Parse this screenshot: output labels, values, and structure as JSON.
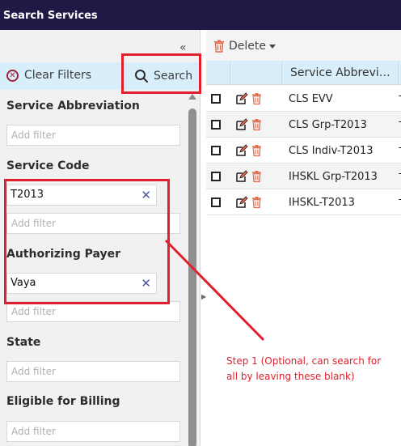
{
  "window": {
    "title": "Search Services"
  },
  "filters": {
    "collapse_glyph": "«",
    "clear_label": "Clear Filters",
    "search_label": "Search",
    "service_abbreviation": {
      "label": "Service Abbreviation",
      "placeholder": "Add filter"
    },
    "service_code": {
      "label": "Service Code",
      "chip": "T2013",
      "placeholder": "Add filter"
    },
    "authorizing_payer": {
      "label": "Authorizing Payer",
      "chip": "Vaya",
      "placeholder": "Add filter"
    },
    "state": {
      "label": "State",
      "placeholder": "Add filter"
    },
    "eligible_for_billing": {
      "label": "Eligible for Billing",
      "placeholder": "Add filter"
    },
    "chip_remove_glyph": "✕"
  },
  "grid": {
    "delete_label": "Delete",
    "column_header": "Service Abbrevi…",
    "rows": [
      {
        "abbreviation": "CLS EVV",
        "tail": "T"
      },
      {
        "abbreviation": "CLS Grp-T2013",
        "tail": "T"
      },
      {
        "abbreviation": "CLS Indiv-T2013",
        "tail": "T"
      },
      {
        "abbreviation": "IHSKL Grp-T2013",
        "tail": "T"
      },
      {
        "abbreviation": "IHSKL-T2013",
        "tail": "T"
      }
    ]
  },
  "annotation": {
    "text": "Step 1 (Optional, can search for all by leaving these blank)",
    "color": "#e0202e"
  },
  "colors": {
    "titlebar": "#1f1a45",
    "filter_bar": "#d9eefb",
    "accent_red": "#e0202e",
    "trash": "#e06a4a",
    "chip_x": "#4a56a8"
  },
  "icons": [
    "collapse-icon",
    "clear-filter-icon",
    "search-icon",
    "trash-icon",
    "edit-icon",
    "remove-chip-icon"
  ]
}
